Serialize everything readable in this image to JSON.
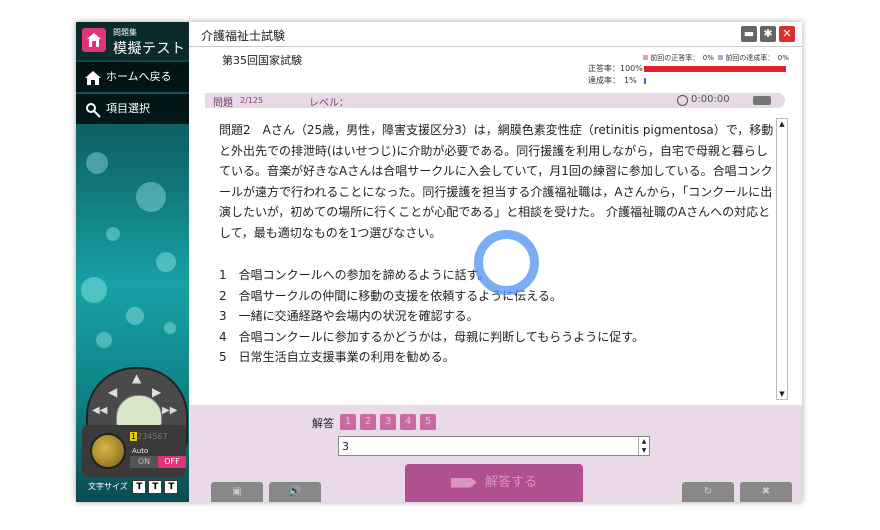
{
  "app": {
    "logo_sub": "問題集",
    "logo_main": "模擬テスト",
    "window_title": "介護福祉士試験",
    "exam_name": "第35回国家試験"
  },
  "sidebar": {
    "items": [
      {
        "label": "ホームへ戻る",
        "icon": "home-icon"
      },
      {
        "label": "項目選択",
        "icon": "cursor-icon"
      }
    ],
    "controller": {
      "numbers": [
        "1",
        "2",
        "3",
        "4",
        "5",
        "6",
        "7"
      ],
      "auto_label": "Auto",
      "on_label": "ON",
      "off_label": "OFF",
      "font_size_label": "文字サイズ",
      "font_buttons": [
        "T",
        "T",
        "T"
      ]
    }
  },
  "stats": {
    "correct_rate_label": "正答率：100%",
    "progress_rate_label": "達成率：　1%",
    "prev_correct_legend": "前回の正答率：　0%",
    "prev_progress_legend": "前回の達成率：　0%",
    "correct_rate": 100,
    "progress_rate": 1,
    "colors": {
      "correct": "#e0202a",
      "progress": "#3a6fd0"
    }
  },
  "question_bar": {
    "label": "問題",
    "number": "2/125",
    "level_label": "レベル：",
    "timer": "0:00:00"
  },
  "question": {
    "text": "問題2　Aさん（25歳，男性，障害支援区分3）は，網膜色素変性症（retinitis pigmentosa）で，移動と外出先での排泄時(はいせつじ)に介助が必要である。同行援護を利用しながら，自宅で母親と暮らしている。音楽が好きなAさんは合唱サークルに入会していて，月1回の練習に参加している。合唱コンクールが遠方で行われることになった。同行援護を担当する介護福祉職は，Aさんから，「コンクールに出演したいが，初めての場所に行くことが心配である」と相談を受けた。 介護福祉職のAさんへの対応として，最も適切なものを1つ選びなさい。",
    "choices": [
      "1　合唱コンクールへの参加を諦めるように話す。",
      "2　合唱サークルの仲間に移動の支援を依頼するように伝える。",
      "3　一緒に交通経路や会場内の状況を確認する。",
      "4　合唱コンクールに参加するかどうかは，母親に判断してもらうように促す。",
      "5　日常生活自立支援事業の利用を勧める。"
    ]
  },
  "answer": {
    "label": "解答",
    "options": [
      "1",
      "2",
      "3",
      "4",
      "5"
    ],
    "input_value": "3",
    "submit_label": "解答する"
  }
}
